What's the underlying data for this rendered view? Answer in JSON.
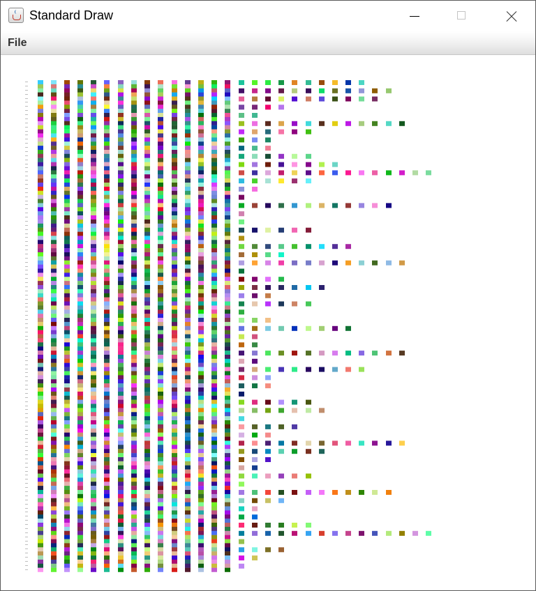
{
  "window": {
    "title": "Standard Draw",
    "icon": "java-cup-icon",
    "controls": [
      "minimize-icon",
      "maximize-icon",
      "close-icon"
    ]
  },
  "menu": {
    "items": [
      {
        "label": "File"
      }
    ]
  },
  "canvas": {
    "background": "#ffffff"
  }
}
